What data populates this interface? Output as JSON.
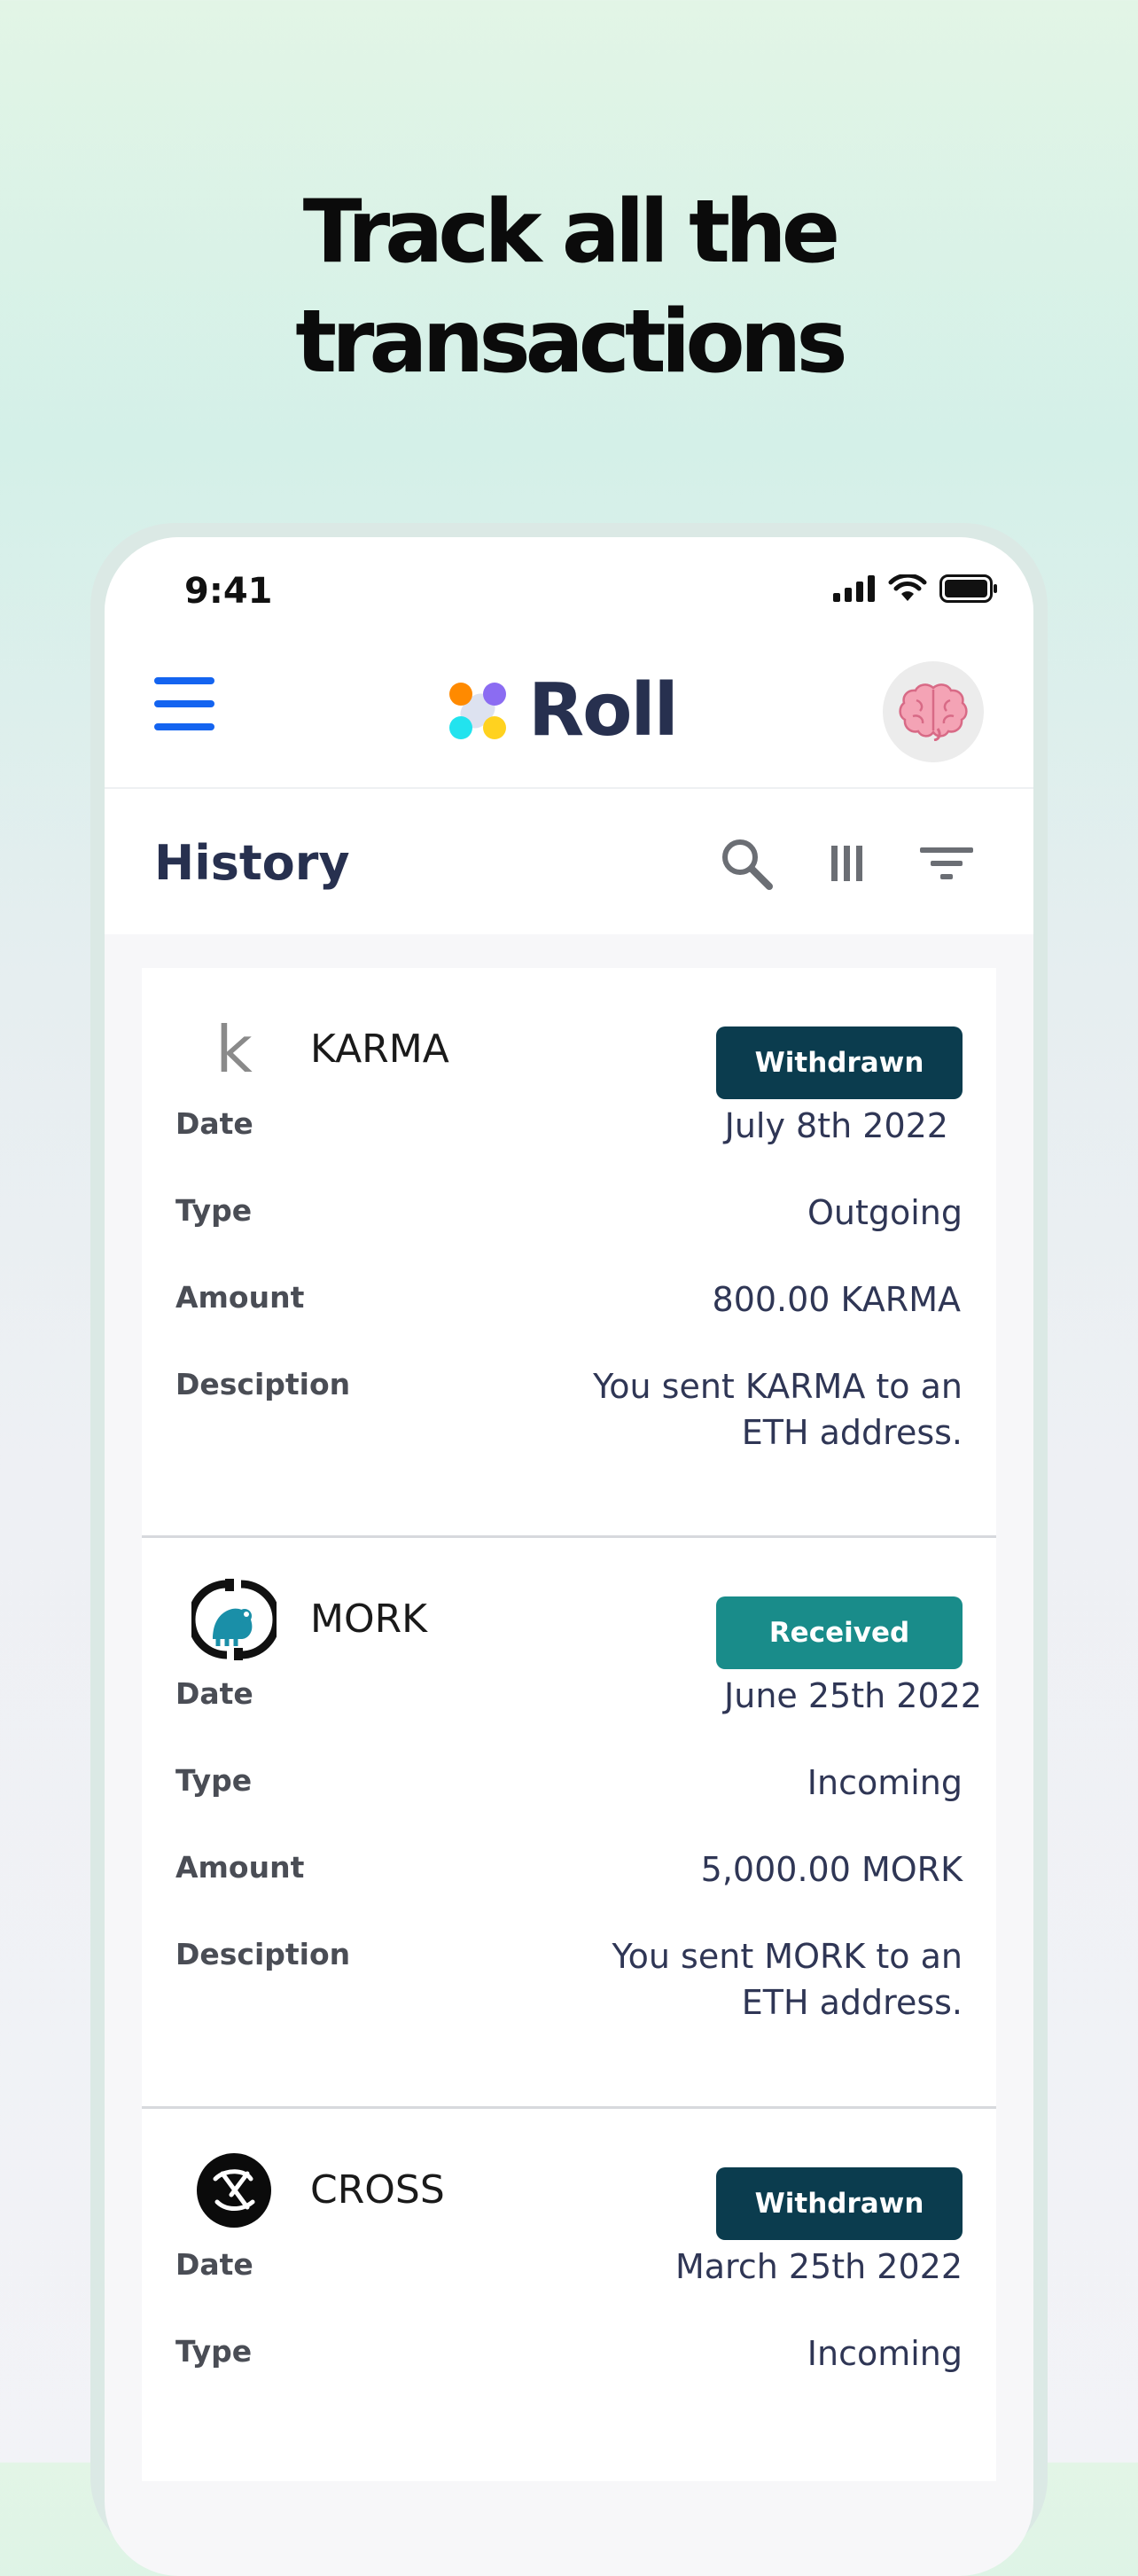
{
  "hero": {
    "line1": "Track all the",
    "line2": "transactions"
  },
  "status_bar": {
    "time": "9:41"
  },
  "app": {
    "name": "Roll"
  },
  "page": {
    "title": "History"
  },
  "colors": {
    "withdrawn": "#0b3c4e",
    "received": "#198c8a",
    "menu": "#1464f0",
    "title": "#27304f"
  },
  "transactions": [
    {
      "coin": "KARMA",
      "icon": "karma-k-icon",
      "icon_glyph": "k",
      "status": "Withdrawn",
      "status_color": "#0b3c4e",
      "rows": [
        {
          "label": "Date",
          "value": "July 8th 2022"
        },
        {
          "label": "Type",
          "value": "Outgoing"
        },
        {
          "label": "Amount",
          "value": "800.00 KARMA"
        },
        {
          "label": "Desciption",
          "value": "You sent KARMA to an",
          "value2": "ETH address."
        }
      ]
    },
    {
      "coin": "MORK",
      "icon": "mork-logo-icon",
      "status": "Received",
      "status_color": "#198c8a",
      "rows": [
        {
          "label": "Date",
          "value": "June 25th 2022"
        },
        {
          "label": "Type",
          "value": "Incoming"
        },
        {
          "label": "Amount",
          "value": "5,000.00 MORK"
        },
        {
          "label": "Desciption",
          "value": "You sent MORK to an",
          "value2": "ETH address."
        }
      ]
    },
    {
      "coin": "CROSS",
      "icon": "cross-logo-icon",
      "status": "Withdrawn",
      "status_color": "#0b3c4e",
      "rows": [
        {
          "label": "Date",
          "value": "March 25th 2022"
        },
        {
          "label": "Type",
          "value": "Incoming"
        }
      ]
    }
  ]
}
